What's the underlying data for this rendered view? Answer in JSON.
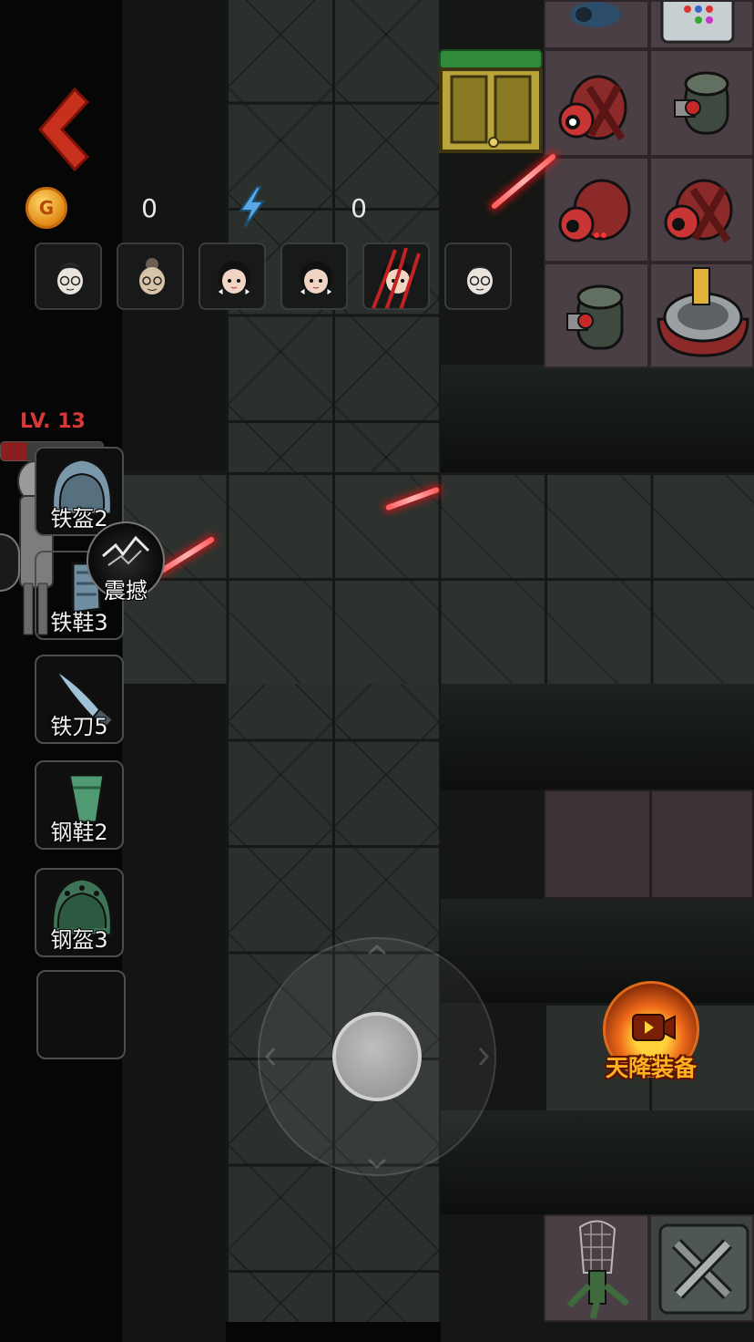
{
  "hud": {
    "coin_icon_letter": "G",
    "coin_count": "0",
    "energy_count": "0"
  },
  "allies": [
    {
      "name": "ally-boy-glasses",
      "hair": "#2a2a2a"
    },
    {
      "name": "ally-grandma",
      "hair": "#6b5d52"
    },
    {
      "name": "ally-girl-bow",
      "hair": "#111111"
    },
    {
      "name": "ally-girl-bow",
      "hair": "#111111"
    },
    {
      "name": "ally-girl-bow-attacked",
      "hair": "#111111"
    },
    {
      "name": "ally-boy-glasses",
      "hair": "#2a2a2a"
    }
  ],
  "player": {
    "level_text": "LV. 13",
    "hp_fraction": 0.25
  },
  "equipment": [
    {
      "label": "铁盔2",
      "icon": "iron-helmet-icon"
    },
    {
      "label": "铁鞋3",
      "icon": "iron-boots-icon"
    },
    {
      "label": "铁刀5",
      "icon": "iron-knife-icon"
    },
    {
      "label": "钢鞋2",
      "icon": "steel-boots-icon"
    },
    {
      "label": "钢盔3",
      "icon": "steel-helmet-icon"
    },
    {
      "label": "",
      "icon": "empty-slot"
    }
  ],
  "skill": {
    "label": "震撼",
    "icon": "lightning-shock-icon"
  },
  "drop_button": {
    "label": "天降装备",
    "icon": "video-ad-icon"
  },
  "colors": {
    "level_red": "#d7393a",
    "hp_red": "#8c1e1f",
    "drop_orange": "#ffb020",
    "door_gold": "#b8a43a",
    "door_bar_green": "#2f8a3c",
    "laser_red": "#ff4040"
  }
}
